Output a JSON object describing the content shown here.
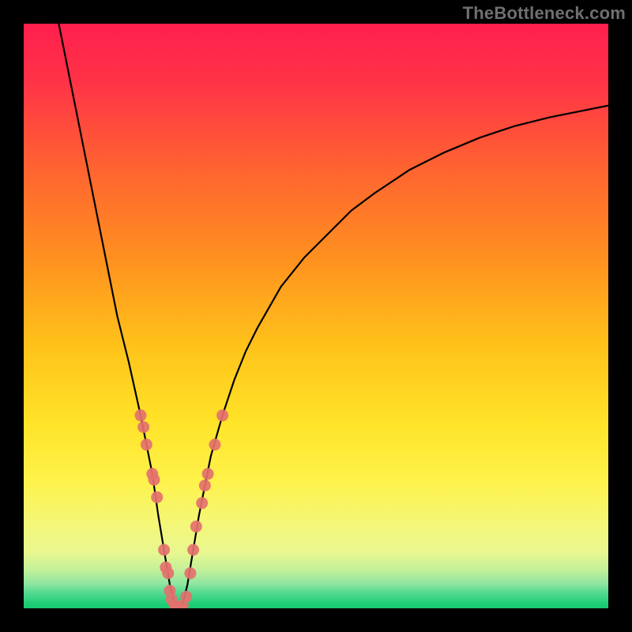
{
  "watermark": "TheBottleneck.com",
  "chart_data": {
    "type": "line",
    "title": "",
    "xlabel": "",
    "ylabel": "",
    "xlim": [
      0,
      100
    ],
    "ylim": [
      0,
      100
    ],
    "curve": {
      "name": "bottleneck-curve",
      "x": [
        6,
        8,
        10,
        12,
        14,
        16,
        18,
        20,
        22,
        23,
        24,
        25,
        26,
        27,
        28,
        29,
        30,
        32,
        34,
        36,
        38,
        40,
        44,
        48,
        52,
        56,
        60,
        66,
        72,
        78,
        84,
        90,
        96,
        100
      ],
      "y": [
        100,
        90,
        80,
        70,
        60,
        50,
        42,
        33,
        23,
        16,
        10,
        4,
        0,
        0,
        4,
        10,
        16,
        26,
        33,
        39,
        44,
        48,
        55,
        60,
        64,
        68,
        71,
        75,
        78,
        80.5,
        82.5,
        84,
        85.2,
        86
      ]
    },
    "scatter": {
      "name": "data-points",
      "color": "#e4716e",
      "points": [
        {
          "x": 20.0,
          "y": 33
        },
        {
          "x": 20.5,
          "y": 31
        },
        {
          "x": 21.0,
          "y": 28
        },
        {
          "x": 22.0,
          "y": 23
        },
        {
          "x": 22.3,
          "y": 22
        },
        {
          "x": 22.8,
          "y": 19
        },
        {
          "x": 24.0,
          "y": 10
        },
        {
          "x": 24.3,
          "y": 7
        },
        {
          "x": 24.7,
          "y": 6
        },
        {
          "x": 25.0,
          "y": 3
        },
        {
          "x": 25.3,
          "y": 1.5
        },
        {
          "x": 25.8,
          "y": 0.5
        },
        {
          "x": 26.2,
          "y": 0
        },
        {
          "x": 26.7,
          "y": 0
        },
        {
          "x": 27.2,
          "y": 0.5
        },
        {
          "x": 27.8,
          "y": 2
        },
        {
          "x": 28.5,
          "y": 6
        },
        {
          "x": 29.0,
          "y": 10
        },
        {
          "x": 29.5,
          "y": 14
        },
        {
          "x": 30.5,
          "y": 18
        },
        {
          "x": 31.0,
          "y": 21
        },
        {
          "x": 31.5,
          "y": 23
        },
        {
          "x": 32.7,
          "y": 28
        },
        {
          "x": 34.0,
          "y": 33
        }
      ]
    },
    "gradient_stops": [
      {
        "offset": 0.0,
        "color": "#ff1f4e"
      },
      {
        "offset": 0.1,
        "color": "#ff3347"
      },
      {
        "offset": 0.25,
        "color": "#ff6430"
      },
      {
        "offset": 0.4,
        "color": "#ff9020"
      },
      {
        "offset": 0.55,
        "color": "#ffc21a"
      },
      {
        "offset": 0.68,
        "color": "#ffe328"
      },
      {
        "offset": 0.78,
        "color": "#fff24a"
      },
      {
        "offset": 0.86,
        "color": "#f3f77a"
      },
      {
        "offset": 0.905,
        "color": "#e8f78f"
      },
      {
        "offset": 0.935,
        "color": "#c2f09a"
      },
      {
        "offset": 0.958,
        "color": "#8fe6a0"
      },
      {
        "offset": 0.975,
        "color": "#4fd88f"
      },
      {
        "offset": 0.992,
        "color": "#1fce78"
      },
      {
        "offset": 1.0,
        "color": "#15c96f"
      }
    ]
  }
}
